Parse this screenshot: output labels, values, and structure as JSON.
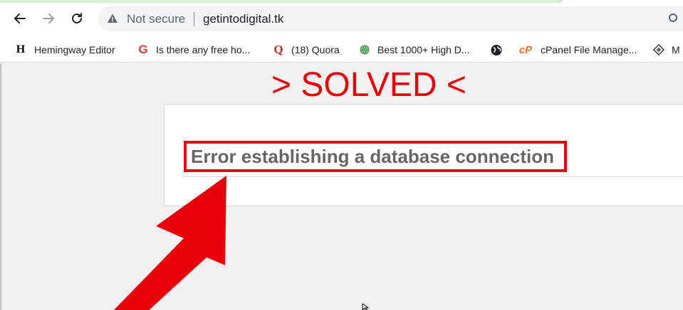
{
  "browser": {
    "security_label": "Not secure",
    "url": "getintodigital.tk"
  },
  "bookmarks": [
    {
      "label": "Hemingway Editor",
      "icon": "H"
    },
    {
      "label": "Is there any free ho...",
      "icon": "G"
    },
    {
      "label": "(18) Quora",
      "icon": "Q"
    },
    {
      "label": "Best 1000+ High D...",
      "icon": "globe"
    },
    {
      "label": "",
      "icon": "world"
    },
    {
      "label": "cPanel File Manage...",
      "icon": "cP"
    },
    {
      "label": "M",
      "icon": "diamond"
    }
  ],
  "page": {
    "banner": "> SOLVED <",
    "error_title": "Error establishing a database connection"
  },
  "colors": {
    "annotation_red": "#e8000b",
    "error_text": "#666666",
    "page_bg": "#f1f1f1"
  }
}
